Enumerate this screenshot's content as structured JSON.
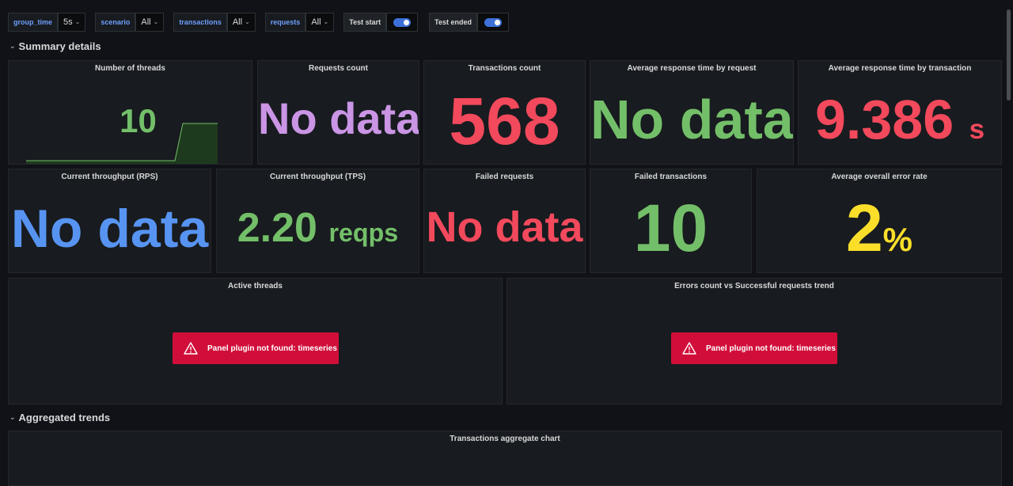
{
  "variables": [
    {
      "label": "group_time",
      "value": "5s"
    },
    {
      "label": "scenario",
      "value": "All"
    },
    {
      "label": "transactions",
      "value": "All"
    },
    {
      "label": "requests",
      "value": "All"
    }
  ],
  "toggles": [
    {
      "label": "Test start",
      "on": true
    },
    {
      "label": "Test ended",
      "on": true
    }
  ],
  "rows": {
    "summary": "Summary details",
    "aggregated": "Aggregated trends"
  },
  "stats": {
    "threads": {
      "title": "Number of threads",
      "value": "10",
      "color": "#73bf69"
    },
    "requests_count": {
      "title": "Requests count",
      "value": "No data",
      "color": "#ca95e5"
    },
    "transactions_count": {
      "title": "Transactions count",
      "value": "568",
      "color": "#f2495c"
    },
    "avg_resp_request": {
      "title": "Average response time by request",
      "value": "No data",
      "color": "#73bf69"
    },
    "avg_resp_transaction": {
      "title": "Average response time by transaction",
      "value": "9.386",
      "unit": "s",
      "color": "#f2495c"
    },
    "throughput_rps": {
      "title": "Current throughput (RPS)",
      "value": "No data",
      "color": "#5794f2"
    },
    "throughput_tps": {
      "title": "Current throughput (TPS)",
      "value": "2.20",
      "unit": "reqps",
      "color": "#73bf69"
    },
    "failed_requests": {
      "title": "Failed requests",
      "value": "No data",
      "color": "#f2495c"
    },
    "failed_transactions": {
      "title": "Failed transactions",
      "value": "10",
      "color": "#73bf69"
    },
    "error_rate": {
      "title": "Average overall error rate",
      "value": "2",
      "unit": "%",
      "color": "#fade2a"
    }
  },
  "timeseries_panels": {
    "active_threads": {
      "title": "Active threads",
      "error": "Panel plugin not found: timeseries"
    },
    "errors_vs_success": {
      "title": "Errors count vs Successful requests trend",
      "error": "Panel plugin not found: timeseries"
    },
    "transactions_aggregate": {
      "title": "Transactions aggregate chart"
    }
  },
  "icons": {
    "warning": "warning-triangle-icon",
    "chevron": "chevron-down-icon"
  },
  "colors": {
    "error_bg": "#d10e3a",
    "toggle_on": "#3d71d9",
    "var_label": "#6e9fff"
  }
}
